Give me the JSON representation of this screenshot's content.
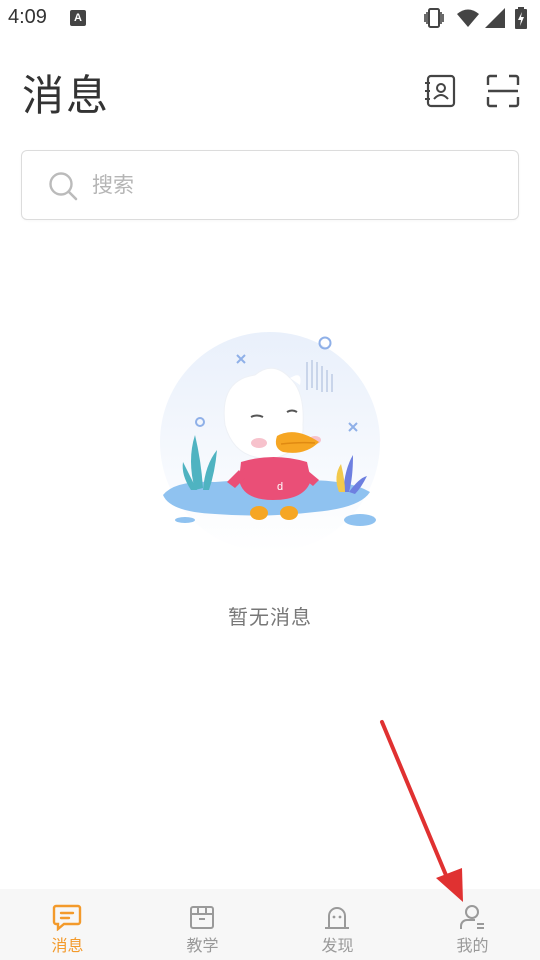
{
  "status_bar": {
    "time": "4:09",
    "notification_icon": "A"
  },
  "header": {
    "title": "消息",
    "icons": [
      "contacts-icon",
      "scan-icon"
    ]
  },
  "search": {
    "placeholder": "搜索",
    "value": ""
  },
  "empty_state": {
    "message": "暂无消息"
  },
  "tab_bar": {
    "tabs": [
      {
        "label": "消息",
        "icon": "message-icon",
        "active": true
      },
      {
        "label": "教学",
        "icon": "teaching-box-icon",
        "active": false
      },
      {
        "label": "发现",
        "icon": "discover-ghost-icon",
        "active": false
      },
      {
        "label": "我的",
        "icon": "profile-icon",
        "active": false
      }
    ]
  },
  "colors": {
    "accent": "#f39a2b",
    "inactive": "#999999",
    "annotation": "#e03131"
  }
}
